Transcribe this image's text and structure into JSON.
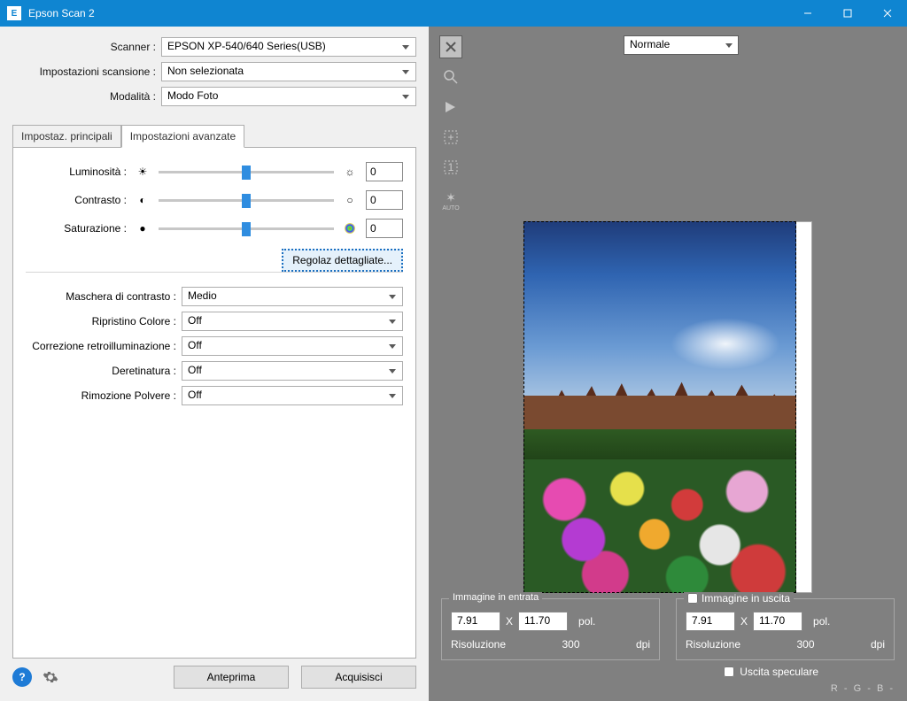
{
  "window": {
    "title": "Epson Scan 2"
  },
  "header": {
    "scanner_label": "Scanner :",
    "scanner_value": "EPSON XP-540/640 Series(USB)",
    "scan_settings_label": "Impostazioni scansione :",
    "scan_settings_value": "Non selezionata",
    "mode_label": "Modalità :",
    "mode_value": "Modo Foto"
  },
  "tabs": {
    "main": "Impostaz. principali",
    "advanced": "Impostazioni avanzate"
  },
  "sliders": {
    "brightness": {
      "label": "Luminosità :",
      "value": "0"
    },
    "contrast": {
      "label": "Contrasto :",
      "value": "0"
    },
    "saturation": {
      "label": "Saturazione :",
      "value": "0"
    },
    "detail_button": "Regolaz dettagliate..."
  },
  "options": {
    "unsharp": {
      "label": "Maschera di contrasto :",
      "value": "Medio"
    },
    "restore": {
      "label": "Ripristino Colore :",
      "value": "Off"
    },
    "backlight": {
      "label": "Correzione retroilluminazione :",
      "value": "Off"
    },
    "descreen": {
      "label": "Deretinatura :",
      "value": "Off"
    },
    "dust": {
      "label": "Rimozione Polvere :",
      "value": "Off"
    }
  },
  "bottom": {
    "preview": "Anteprima",
    "scan": "Acquisisci"
  },
  "right": {
    "view_mode": "Normale",
    "input": {
      "title": "Immagine in entrata",
      "w": "7.91",
      "h": "11.70",
      "unit": "pol.",
      "res_label": "Risoluzione",
      "res_value": "300",
      "res_unit": "dpi"
    },
    "output": {
      "title": "Immagine in uscita",
      "w": "7.91",
      "h": "11.70",
      "unit": "pol.",
      "res_label": "Risoluzione",
      "res_value": "300",
      "res_unit": "dpi"
    },
    "mirror": "Uscita speculare",
    "rgb": "R   -    G   -    B   -"
  }
}
